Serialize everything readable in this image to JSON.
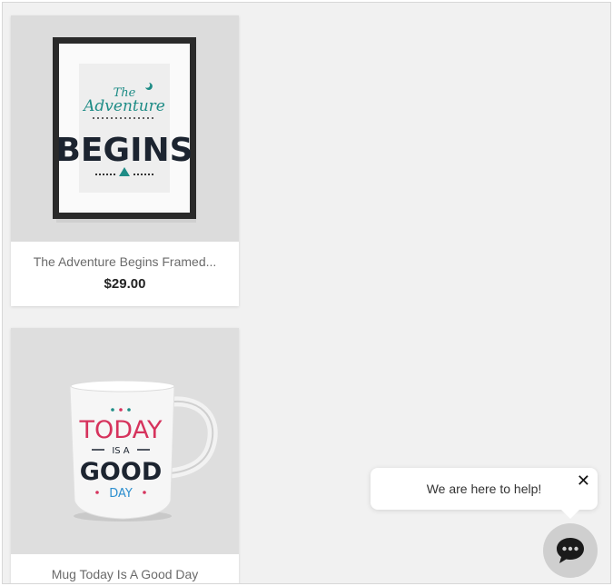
{
  "products": [
    {
      "name": "The Adventure Begins Framed...",
      "price": "$29.00",
      "image": "framed-poster-adventure-begins",
      "poster_art": {
        "line1": "The",
        "line2": "Adventure",
        "line3": "BEGINS"
      }
    },
    {
      "name": "Mug Today Is A Good Day",
      "image": "mug-today-is-a-good-day",
      "mug_art": {
        "line1": "TODAY",
        "line2": "IS A",
        "line3": "GOOD",
        "line4": "DAY"
      }
    }
  ],
  "chat": {
    "message": "We are here to help!",
    "close_icon": "close-icon",
    "button_icon": "chat-bubble-icon"
  },
  "colors": {
    "background": "#f1f1f1",
    "card": "#ffffff",
    "teal": "#1e8c86",
    "pink": "#d6335d",
    "blue": "#2d8fcf"
  }
}
